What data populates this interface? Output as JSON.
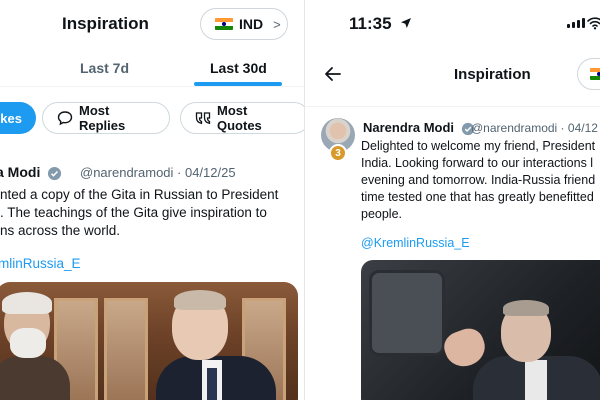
{
  "left_screen": {
    "title": "Inspiration",
    "country_selector": {
      "label": "IND",
      "flag": "india-flag-icon",
      "chevron": ">"
    },
    "time_tabs": [
      {
        "label": "Last 7d",
        "selected": false
      },
      {
        "label": "Last 30d",
        "selected": true
      }
    ],
    "sort_chips": [
      {
        "label": "kes",
        "selected": true
      },
      {
        "label": "Most Replies",
        "icon": "reply-bubble-icon"
      },
      {
        "label": "Most Quotes",
        "icon": "quote-icon"
      }
    ],
    "post": {
      "author": "a Modi",
      "handle_date": "@narendramodi · 04/12/25",
      "lines": [
        "nted a copy of the Gita in Russian to President",
        ". The teachings of the Gita give inspiration to",
        "ns across the world."
      ],
      "mention": "mlinRussia_E"
    }
  },
  "right_screen": {
    "status_time": "11:35",
    "title": "Inspiration",
    "post": {
      "author": "Narendra Modi",
      "handle_date": "@narendramodi · 04/12",
      "rank_badge": "3",
      "lines": [
        "Delighted to welcome my friend, President",
        "India. Looking forward to our interactions l",
        "evening and tomorrow. India-Russia friend",
        "time tested one that has greatly benefitted",
        "people."
      ],
      "mention": "@KremlinRussia_E"
    }
  },
  "colors": {
    "accent": "#1d9bf0",
    "text": "#0f1419",
    "secondary": "#536471",
    "badge": "#d89b2b"
  }
}
